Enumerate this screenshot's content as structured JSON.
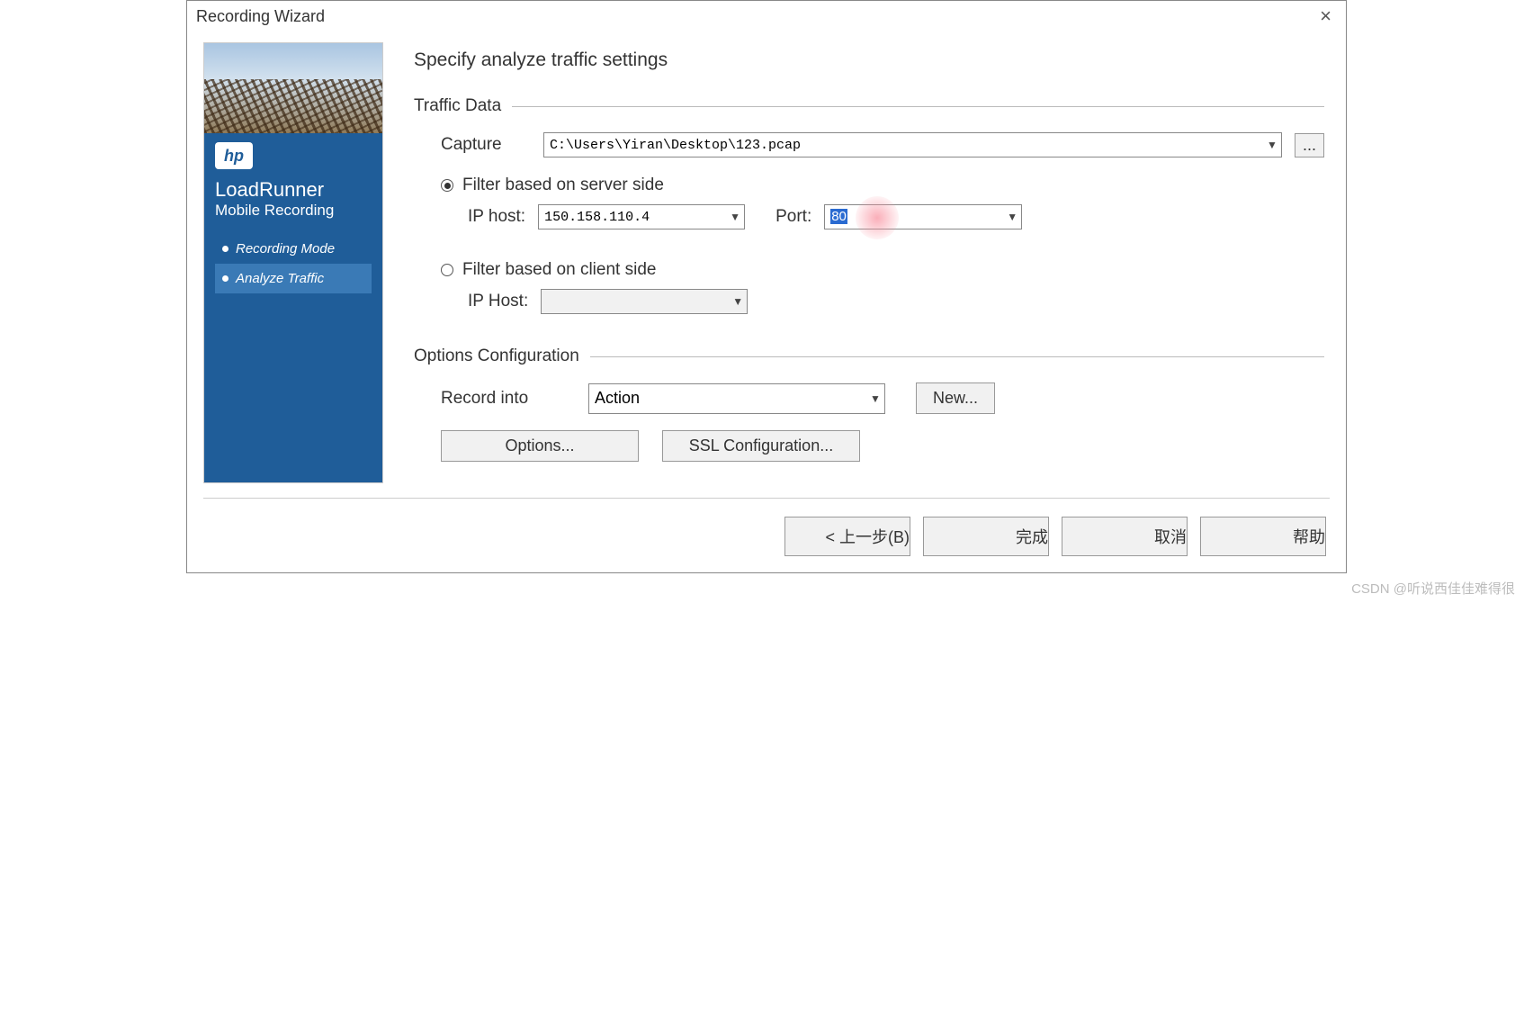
{
  "window": {
    "title": "Recording Wizard"
  },
  "sidebar": {
    "brand_title": "LoadRunner",
    "brand_sub": "Mobile Recording",
    "items": [
      {
        "label": "Recording Mode"
      },
      {
        "label": "Analyze Traffic"
      }
    ]
  },
  "main": {
    "heading": "Specify analyze traffic settings",
    "traffic_data_label": "Traffic Data",
    "capture_label": "Capture",
    "capture_value": "C:\\Users\\Yiran\\Desktop\\123.pcap",
    "browse_label": "...",
    "filter_server_label": "Filter based on server side",
    "ip_host_label_server": "IP host:",
    "ip_host_value_server": "150.158.110.4",
    "port_label": "Port:",
    "port_value": "80",
    "filter_client_label": "Filter based on client side",
    "ip_host_label_client": "IP Host:",
    "ip_host_value_client": "",
    "options_config_label": "Options Configuration",
    "record_into_label": "Record into",
    "record_into_value": "Action",
    "new_button": "New...",
    "options_button": "Options...",
    "ssl_button": "SSL Configuration..."
  },
  "footer": {
    "back": "< 上一步(B)",
    "finish": "完成",
    "cancel": "取消",
    "help": "帮助"
  },
  "watermark": "CSDN @听说西佳佳难得很"
}
